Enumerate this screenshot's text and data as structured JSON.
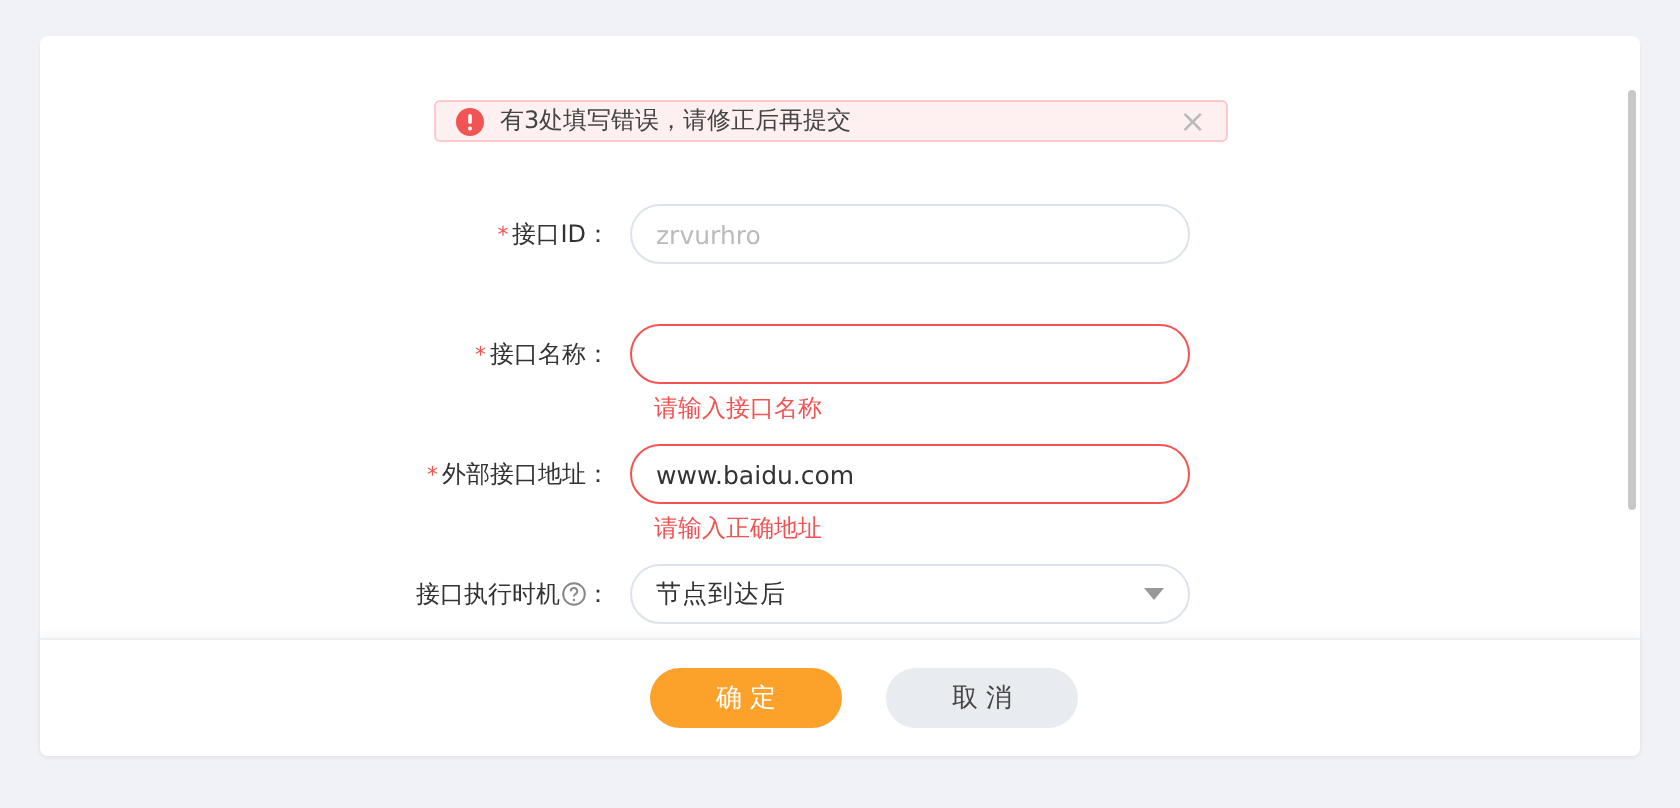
{
  "alert": {
    "message": "有3处填写错误，请修正后再提交",
    "close": "×"
  },
  "fields": [
    {
      "kind": "input",
      "mark": "*",
      "label": "接口ID：",
      "help": false,
      "placeholder": "zrvurhro",
      "invalid": false
    },
    {
      "kind": "input",
      "mark": "*",
      "label": "接口名称：",
      "help": false,
      "invalid": true,
      "error": "请输入接口名称"
    },
    {
      "kind": "input",
      "mark": "*",
      "label": "外部接口地址：",
      "help": false,
      "value": "www.baidu.com",
      "invalid": true,
      "error": "请输入正确地址"
    },
    {
      "kind": "select",
      "label": "接口执行时机",
      "help": true,
      "label_suffix": "：",
      "value": "节点到达后",
      "invalid": false
    }
  ],
  "buttons": [
    {
      "label": "确 定",
      "kind": "primary"
    },
    {
      "label": "取 消",
      "kind": "secondary"
    }
  ]
}
